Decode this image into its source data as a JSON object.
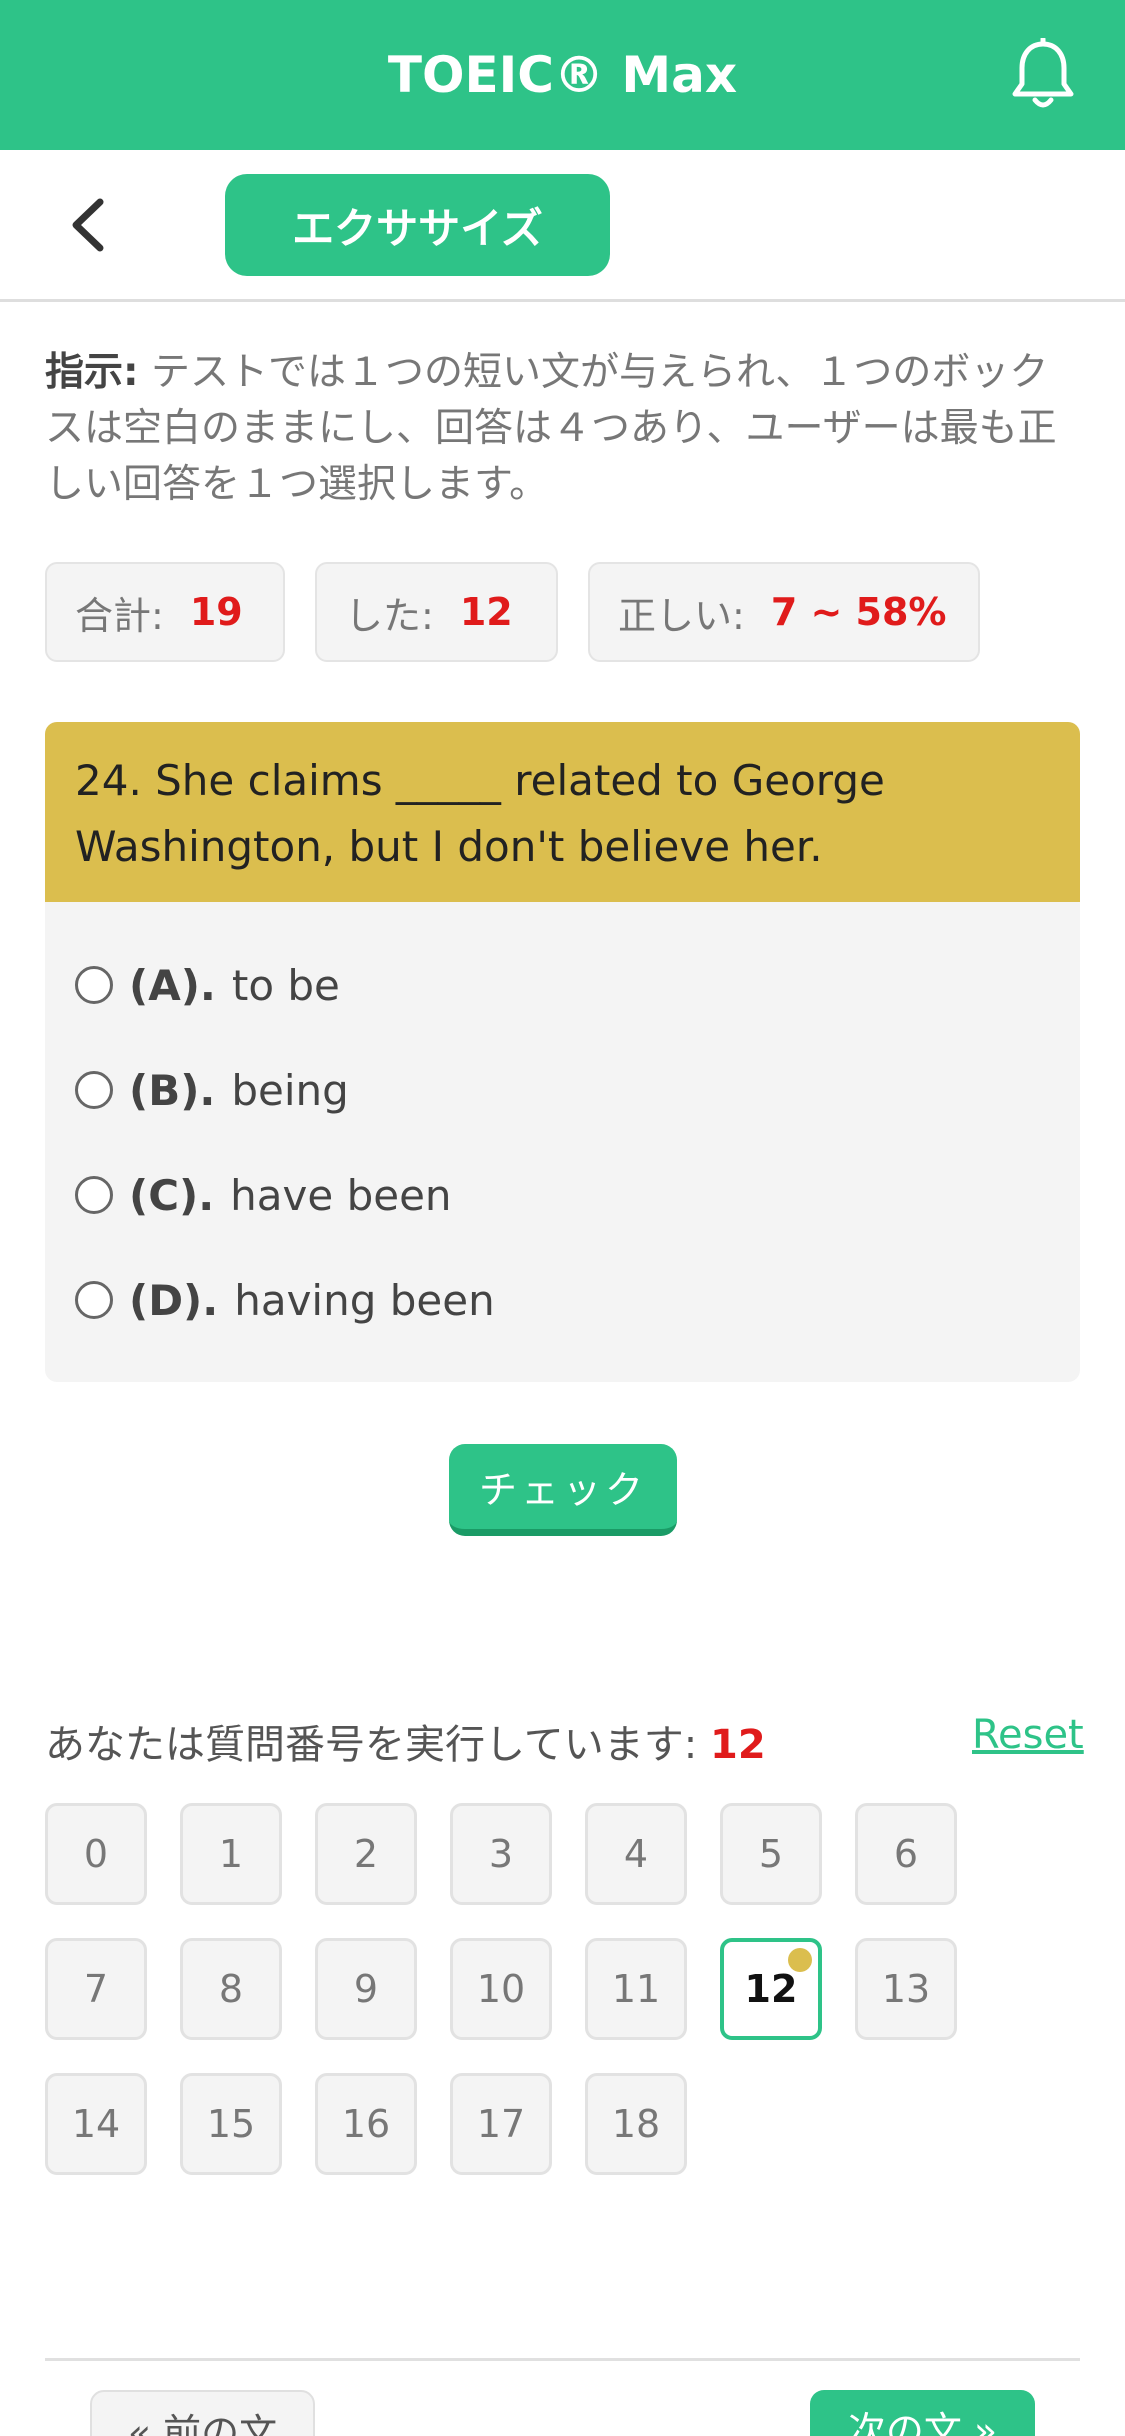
{
  "app": {
    "title": "TOEIC® Max"
  },
  "subbar": {
    "exercise_label": "エクササイズ"
  },
  "instructions": {
    "lead": "指示:",
    "text": " テストでは１つの短い文が与えられ、１つのボックスは空白のままにし、回答は４つあり、ユーザーは最も正しい回答を１つ選択します。"
  },
  "stats": [
    {
      "label": "合計:",
      "value": "19"
    },
    {
      "label": "した:",
      "value": "12"
    },
    {
      "label": "正しい:",
      "value": "7 ~ 58%"
    }
  ],
  "question": {
    "text": "24. She claims _____ related to George Washington, but I don't believe her.",
    "options": [
      {
        "label": "(A).",
        "text": "to be"
      },
      {
        "label": "(B).",
        "text": "being"
      },
      {
        "label": "(C).",
        "text": "have been"
      },
      {
        "label": "(D).",
        "text": "having been"
      }
    ]
  },
  "check_label": "チェック",
  "progress": {
    "label": "あなたは質問番号を実行しています:",
    "current": "12",
    "reset_label": "Reset",
    "numbers": [
      "0",
      "1",
      "2",
      "3",
      "4",
      "5",
      "6",
      "7",
      "8",
      "9",
      "10",
      "11",
      "12",
      "13",
      "14",
      "15",
      "16",
      "17",
      "18"
    ]
  },
  "nav": {
    "prev_label": "« 前の文",
    "next_label": "次の文 »"
  },
  "colors": {
    "accent": "#2ec388",
    "question_header": "#dbbe4e",
    "highlight": "#e01b1b"
  }
}
